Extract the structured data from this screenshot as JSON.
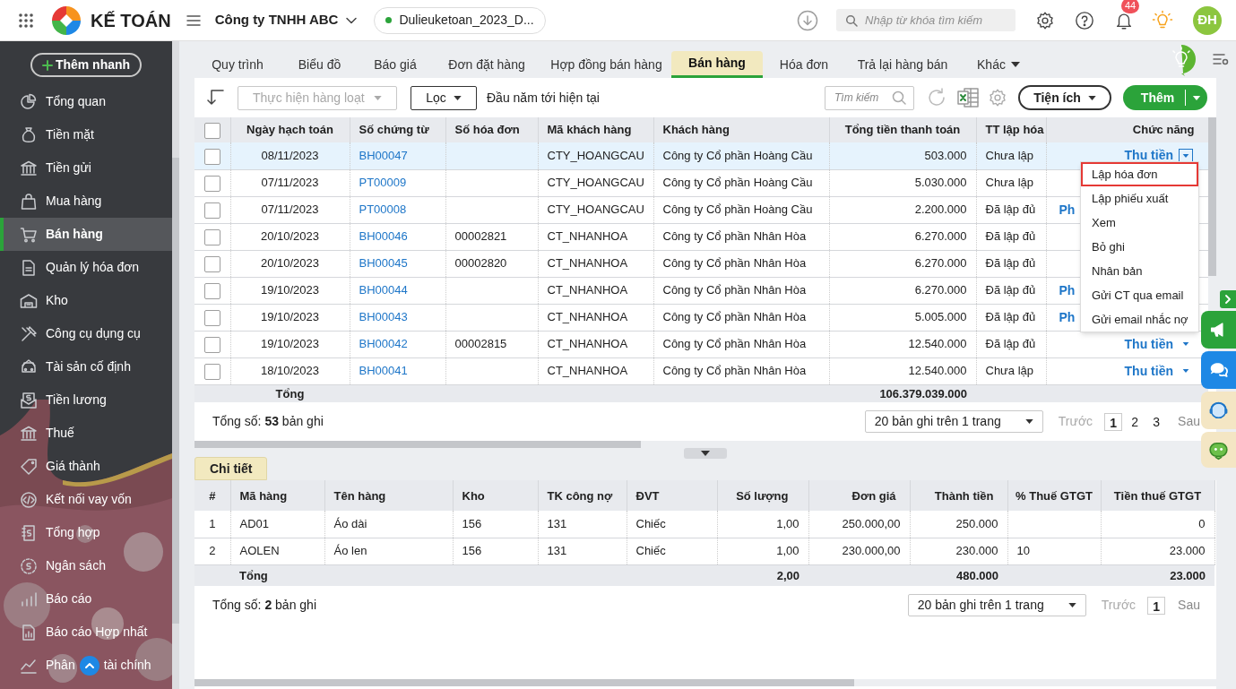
{
  "topbar": {
    "brand": "KẾ TOÁN",
    "company": "Công ty TNHH ABC",
    "database": "Dulieuketoan_2023_D...",
    "search_placeholder": "Nhập từ khóa tìm kiếm",
    "notification_count": "44",
    "avatar": "ĐH"
  },
  "sidebar": {
    "quick_add": "Thêm nhanh",
    "items": [
      {
        "label": "Tổng quan",
        "selected": false
      },
      {
        "label": "Tiền mặt",
        "selected": false
      },
      {
        "label": "Tiền gửi",
        "selected": false
      },
      {
        "label": "Mua hàng",
        "selected": false
      },
      {
        "label": "Bán hàng",
        "selected": true
      },
      {
        "label": "Quản lý hóa đơn",
        "selected": false
      },
      {
        "label": "Kho",
        "selected": false
      },
      {
        "label": "Công cụ dụng cụ",
        "selected": false
      },
      {
        "label": "Tài sản cố định",
        "selected": false
      },
      {
        "label": "Tiền lương",
        "selected": false
      },
      {
        "label": "Thuế",
        "selected": false
      },
      {
        "label": "Giá thành",
        "selected": false
      },
      {
        "label": "Kết nối vay vốn",
        "selected": false
      },
      {
        "label": "Tổng hợp",
        "selected": false
      },
      {
        "label": "Ngân sách",
        "selected": false
      },
      {
        "label": "Báo cáo",
        "selected": false
      },
      {
        "label": "Báo cáo Hợp nhất",
        "selected": false
      },
      {
        "label": "Phân",
        "label_rest": "tài chính",
        "selected": false
      }
    ]
  },
  "tabs": [
    {
      "label": "Quy trình",
      "kind": "tab",
      "selected": false
    },
    {
      "label": "Biểu đồ",
      "kind": "tab",
      "selected": false
    },
    {
      "label": "Báo giá",
      "kind": "tab",
      "selected": false
    },
    {
      "label": "Đơn đặt hàng",
      "kind": "tab",
      "selected": false
    },
    {
      "label": "Hợp đồng bán hàng",
      "kind": "tab",
      "selected": false
    },
    {
      "label": "Bán hàng",
      "kind": "tab",
      "selected": true
    },
    {
      "label": "Hóa đơn",
      "kind": "tab",
      "selected": false
    },
    {
      "label": "Trả lại hàng bán",
      "kind": "tab",
      "selected": false
    },
    {
      "label": "Khác",
      "kind": "menu",
      "selected": false
    }
  ],
  "toolbar": {
    "bulk_action": "Thực hiện hàng loạt",
    "filter": "Lọc",
    "period": "Đầu năm tới hiện tại",
    "search_placeholder": "Tìm kiếm",
    "utilities": "Tiện ích",
    "add": "Thêm"
  },
  "table": {
    "all_checked": false,
    "columns": [
      "Ngày hạch toán",
      "Số chứng từ",
      "Số hóa đơn",
      "Mã khách hàng",
      "Khách hàng",
      "Tổng tiền thanh toán",
      "TT lập hóa",
      "Chức năng"
    ],
    "rows": [
      {
        "checked": false,
        "selected": true,
        "date": "08/11/2023",
        "voucher": "BH00047",
        "customer_code": "CTY_HOANGCAU",
        "customer": "Công ty Cổ phần Hoàng Cầu",
        "amount": "503.000",
        "invoice_status": "Chưa lập",
        "action": {
          "label": "Thu tiền",
          "kind": "dropdown",
          "menu_open": true
        }
      },
      {
        "checked": false,
        "selected": false,
        "date": "07/11/2023",
        "voucher": "PT00009",
        "customer_code": "CTY_HOANGCAU",
        "customer": "Công ty Cổ phần Hoàng Cầu",
        "amount": "5.030.000",
        "invoice_status": "Chưa lập"
      },
      {
        "checked": false,
        "selected": false,
        "date": "07/11/2023",
        "voucher": "PT00008",
        "customer_code": "CTY_HOANGCAU",
        "customer": "Công ty Cổ phần Hoàng Cầu",
        "amount": "2.200.000",
        "invoice_status": "Đã lập đủ",
        "action": {
          "label": "Ph",
          "kind": "link"
        }
      },
      {
        "checked": false,
        "selected": false,
        "date": "20/10/2023",
        "voucher": "BH00046",
        "invoice": "00002821",
        "customer_code": "CT_NHANHOA",
        "customer": "Công ty Cổ phần Nhân Hòa",
        "amount": "6.270.000",
        "invoice_status": "Đã lập đủ"
      },
      {
        "checked": false,
        "selected": false,
        "date": "20/10/2023",
        "voucher": "BH00045",
        "invoice": "00002820",
        "customer_code": "CT_NHANHOA",
        "customer": "Công ty Cổ phần Nhân Hòa",
        "amount": "6.270.000",
        "invoice_status": "Đã lập đủ"
      },
      {
        "checked": false,
        "selected": false,
        "date": "19/10/2023",
        "voucher": "BH00044",
        "customer_code": "CT_NHANHOA",
        "customer": "Công ty Cổ phần Nhân Hòa",
        "amount": "6.270.000",
        "invoice_status": "Đã lập đủ",
        "action": {
          "label": "Ph",
          "kind": "link"
        }
      },
      {
        "checked": false,
        "selected": false,
        "date": "19/10/2023",
        "voucher": "BH00043",
        "customer_code": "CT_NHANHOA",
        "customer": "Công ty Cổ phần Nhân Hòa",
        "amount": "5.005.000",
        "invoice_status": "Đã lập đủ",
        "action": {
          "label": "Ph",
          "kind": "link"
        }
      },
      {
        "checked": false,
        "selected": false,
        "date": "19/10/2023",
        "voucher": "BH00042",
        "invoice": "00002815",
        "customer_code": "CT_NHANHOA",
        "customer": "Công ty Cổ phần Nhân Hòa",
        "amount": "12.540.000",
        "invoice_status": "Đã lập đủ",
        "action": {
          "label": "Thu tiền",
          "kind": "dropdown",
          "menu_open": false
        }
      },
      {
        "checked": false,
        "selected": false,
        "date": "18/10/2023",
        "voucher": "BH00041",
        "customer_code": "CT_NHANHOA",
        "customer": "Công ty Cổ phần Nhân Hòa",
        "amount": "12.540.000",
        "invoice_status": "Chưa lập",
        "action": {
          "label": "Thu tiền",
          "kind": "dropdown",
          "menu_open": false
        }
      }
    ],
    "totals": {
      "label": "Tổng",
      "amount": "106.379.039.000"
    },
    "count_text": "Tổng số: **53** bản ghi",
    "page_size": "20 bản ghi trên 1 trang",
    "prev": "Trước",
    "pages": [
      {
        "label": "1",
        "selected": true
      },
      {
        "label": "2",
        "selected": false
      },
      {
        "label": "3",
        "selected": false
      }
    ],
    "next": "Sau"
  },
  "row_menu": {
    "items": [
      {
        "label": "Lập hóa đơn",
        "selected": true
      },
      {
        "label": "Lập phiếu xuất",
        "selected": false
      },
      {
        "label": "Xem",
        "selected": false
      },
      {
        "label": "Bỏ ghi",
        "selected": false
      },
      {
        "label": "Nhân bản",
        "selected": false
      },
      {
        "label": "Gửi CT qua email",
        "selected": false
      },
      {
        "label": "Gửi email nhắc nợ",
        "selected": false
      }
    ]
  },
  "detail": {
    "tab": "Chi tiết",
    "columns": [
      "#",
      "Mã hàng",
      "Tên hàng",
      "Kho",
      "TK công nợ",
      "ĐVT",
      "Số lượng",
      "Đơn giá",
      "Thành tiền",
      "% Thuế GTGT",
      "Tiền thuế GTGT"
    ],
    "rows": [
      {
        "no": "1",
        "code": "AD01",
        "name": "Áo dài",
        "warehouse": "156",
        "account": "131",
        "unit": "Chiếc",
        "quantity": "1,00",
        "price": "250.000,00",
        "amount": "250.000",
        "vat": "0"
      },
      {
        "no": "2",
        "code": "AOLEN",
        "name": "Áo len",
        "warehouse": "156",
        "account": "131",
        "unit": "Chiếc",
        "quantity": "1,00",
        "price": "230.000,00",
        "amount": "230.000",
        "vat_rate": "10",
        "vat": "23.000"
      }
    ],
    "totals": {
      "label": "Tổng",
      "quantity": "2,00",
      "amount": "480.000",
      "vat": "23.000"
    },
    "count_text": "Tổng số: **2** bản ghi",
    "page_size": "20 bản ghi trên 1 trang",
    "prev": "Trước",
    "pages": [
      {
        "label": "1",
        "selected": true
      }
    ],
    "next": "Sau"
  }
}
